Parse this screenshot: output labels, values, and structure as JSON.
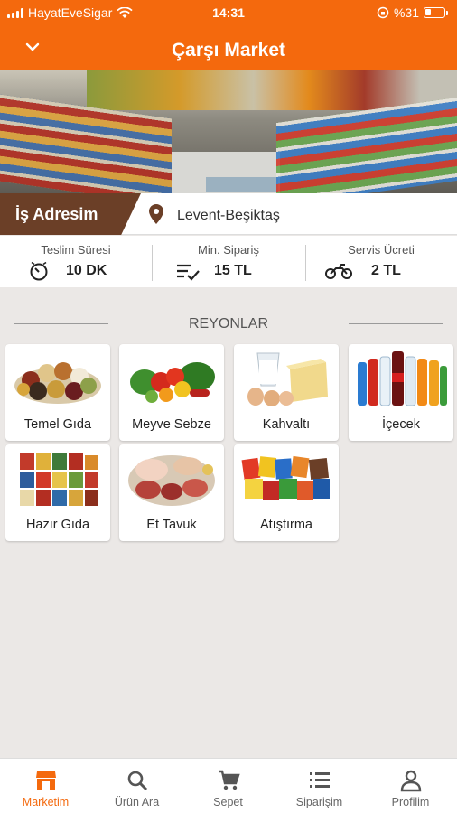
{
  "status": {
    "carrier": "HayatEveSigar",
    "time": "14:31",
    "battery": "%31",
    "icons": [
      "signal-icon",
      "wifi-icon",
      "orientation-lock-icon",
      "battery-icon"
    ]
  },
  "header": {
    "title": "Çarşı Market",
    "back_icon": "chevron-down-icon"
  },
  "colors": {
    "brand": "#f4690d",
    "address_tag": "#6b3f27",
    "background": "#ebe8e6"
  },
  "address": {
    "tag": "İş Adresim",
    "location": "Levent-Beşiktaş",
    "icon": "map-pin-icon"
  },
  "info": {
    "delivery": {
      "label": "Teslim Süresi",
      "value": "10 DK",
      "icon": "timer-icon"
    },
    "min_order": {
      "label": "Min. Sipariş",
      "value": "15 TL",
      "icon": "list-check-icon"
    },
    "service_fee": {
      "label": "Servis Ücreti",
      "value": "2 TL",
      "icon": "motorcycle-icon"
    }
  },
  "sections": {
    "title": "REYONLAR",
    "categories": [
      {
        "label": "Temel Gıda",
        "icon": "legumes-image"
      },
      {
        "label": "Meyve Sebze",
        "icon": "vegetables-image"
      },
      {
        "label": "Kahvaltı",
        "icon": "breakfast-image"
      },
      {
        "label": "İçecek",
        "icon": "drinks-image"
      },
      {
        "label": "Hazır Gıda",
        "icon": "canned-food-image"
      },
      {
        "label": "Et Tavuk",
        "icon": "meat-image"
      },
      {
        "label": "Atıştırma",
        "icon": "snacks-image"
      }
    ]
  },
  "nav": {
    "items": [
      {
        "label": "Marketim",
        "icon": "store-icon",
        "active": true
      },
      {
        "label": "Ürün Ara",
        "icon": "search-icon",
        "active": false
      },
      {
        "label": "Sepet",
        "icon": "cart-icon",
        "active": false
      },
      {
        "label": "Siparişim",
        "icon": "list-icon",
        "active": false
      },
      {
        "label": "Profilim",
        "icon": "user-icon",
        "active": false
      }
    ]
  }
}
